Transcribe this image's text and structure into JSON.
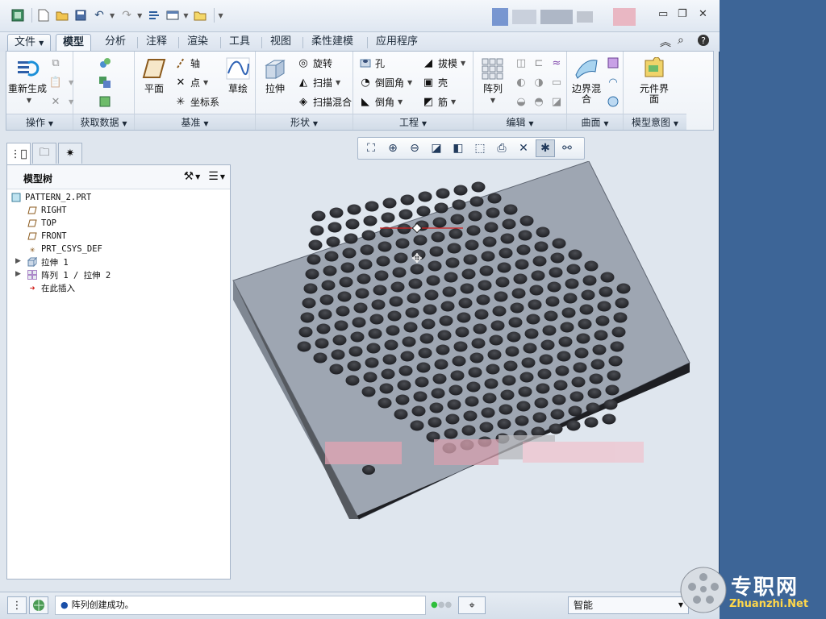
{
  "ribbon": {
    "tabs": {
      "file": "文件",
      "model": "模型",
      "analysis": "分析",
      "annotate": "注释",
      "render": "渲染",
      "tools": "工具",
      "view": "视图",
      "flexible": "柔性建模",
      "apps": "应用程序"
    },
    "groups": {
      "operations": {
        "label": "操作",
        "regen": "重新生成"
      },
      "getdata": {
        "label": "获取数据"
      },
      "datum": {
        "label": "基准",
        "plane": "平面",
        "axis": "轴",
        "point": "点",
        "csys": "坐标系",
        "sketch": "草绘"
      },
      "shapes": {
        "label": "形状",
        "extrude": "拉伸",
        "revolve": "旋转",
        "sweep": "扫描",
        "swept_blend": "扫描混合"
      },
      "engineering": {
        "label": "工程",
        "hole": "孔",
        "round": "倒圆角",
        "chamfer": "倒角",
        "draft": "拔模",
        "shell": "壳",
        "rib": "筋"
      },
      "editing": {
        "label": "编辑",
        "pattern": "阵列"
      },
      "surfaces": {
        "label": "曲面",
        "boundary_blend": "边界混合"
      },
      "intent": {
        "label": "模型意图",
        "component_interface": "元件界面"
      }
    }
  },
  "model_tree": {
    "title": "模型树",
    "items": [
      {
        "label": "PATTERN_2.PRT"
      },
      {
        "label": "RIGHT"
      },
      {
        "label": "TOP"
      },
      {
        "label": "FRONT"
      },
      {
        "label": "PRT_CSYS_DEF"
      },
      {
        "label": "拉伸 1"
      },
      {
        "label": "阵列 1 / 拉伸 2"
      },
      {
        "label": "在此插入"
      }
    ]
  },
  "status": {
    "message": "阵列创建成功。",
    "filter": "智能"
  },
  "watermark": {
    "brand": "专职网",
    "url": "Zhuanzhi.Net"
  },
  "colors": {
    "desktop": "#3d6597",
    "plate_top": "#9ea6b2",
    "plate_side": "#1e1f23",
    "hole": "#2e2f33"
  }
}
